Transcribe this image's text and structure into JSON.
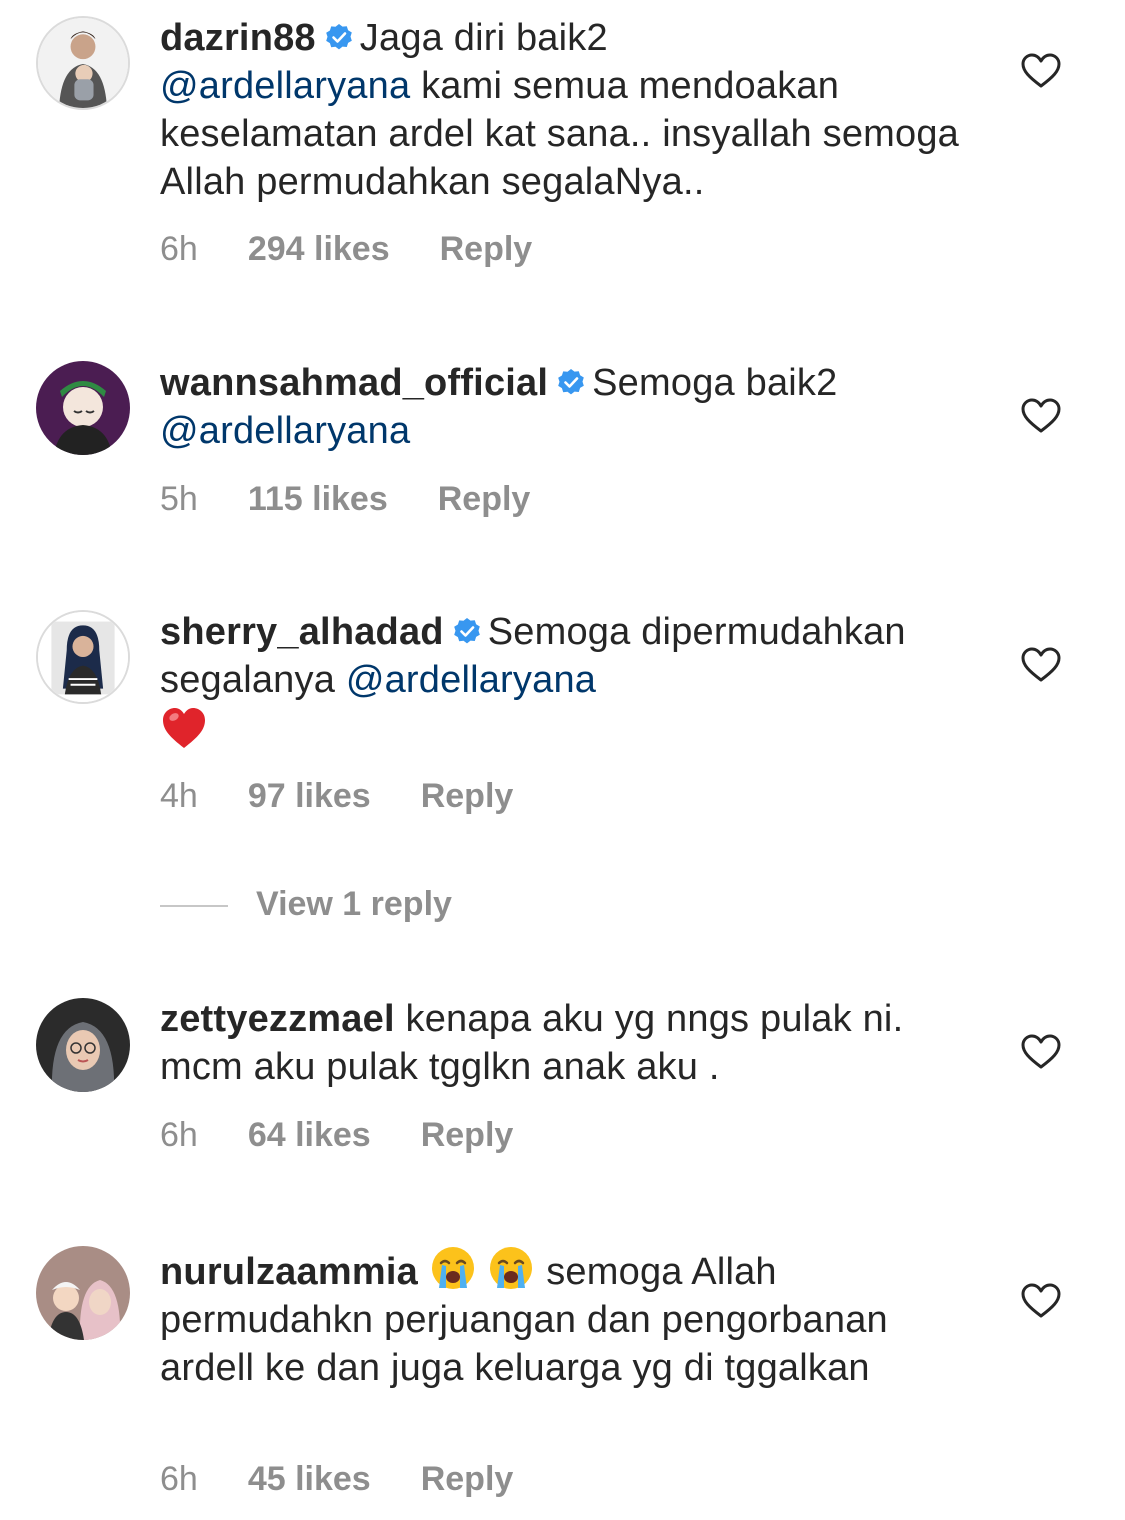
{
  "colors": {
    "text": "#262626",
    "meta": "#8e8e8e",
    "mention": "#00376b",
    "verified": "#3897f0",
    "heart_outline": "#262626"
  },
  "comments": [
    {
      "username": "dazrin88",
      "verified": true,
      "text_before": "Jaga diri baik2",
      "mention_1": "@ardellaryana",
      "text_after": "kami semua mendoakan keselamatan ardel kat sana.. insyallah semoga Allah permudahkan segalaNya..",
      "time": "6h",
      "likes": "294 likes",
      "reply_label": "Reply",
      "avatar_icon": "avatar-man-with-baby"
    },
    {
      "username": "wannsahmad_official",
      "verified": true,
      "text_before": "Semoga baik2",
      "mention_1": "@ardellaryana",
      "time": "5h",
      "likes": "115 likes",
      "reply_label": "Reply",
      "avatar_icon": "avatar-cartoon-cap"
    },
    {
      "username": "sherry_alhadad",
      "verified": true,
      "text_before": "Semoga dipermudahkan segalanya",
      "mention_1": "@ardellaryana",
      "emoji": "red-heart-emoji",
      "time": "4h",
      "likes": "97 likes",
      "reply_label": "Reply",
      "view_replies": "View 1 reply",
      "avatar_icon": "avatar-woman-portrait"
    },
    {
      "username": "zettyezzmael",
      "verified": false,
      "text_before": "kenapa aku yg nngs pulak ni. mcm aku pulak tgglkn anak aku .",
      "time": "6h",
      "likes": "64 likes",
      "reply_label": "Reply",
      "avatar_icon": "avatar-woman-hijab"
    },
    {
      "username": "nurulzaammia",
      "verified": false,
      "emoji": "loudly-crying-face-emoji x2",
      "text_before": "semoga Allah permudahkn perjuangan dan pengorbanan ardell ke  dan juga keluarga yg di tggalkan",
      "time": "6h",
      "likes": "45 likes",
      "reply_label": "Reply",
      "avatar_icon": "avatar-two-people"
    }
  ]
}
